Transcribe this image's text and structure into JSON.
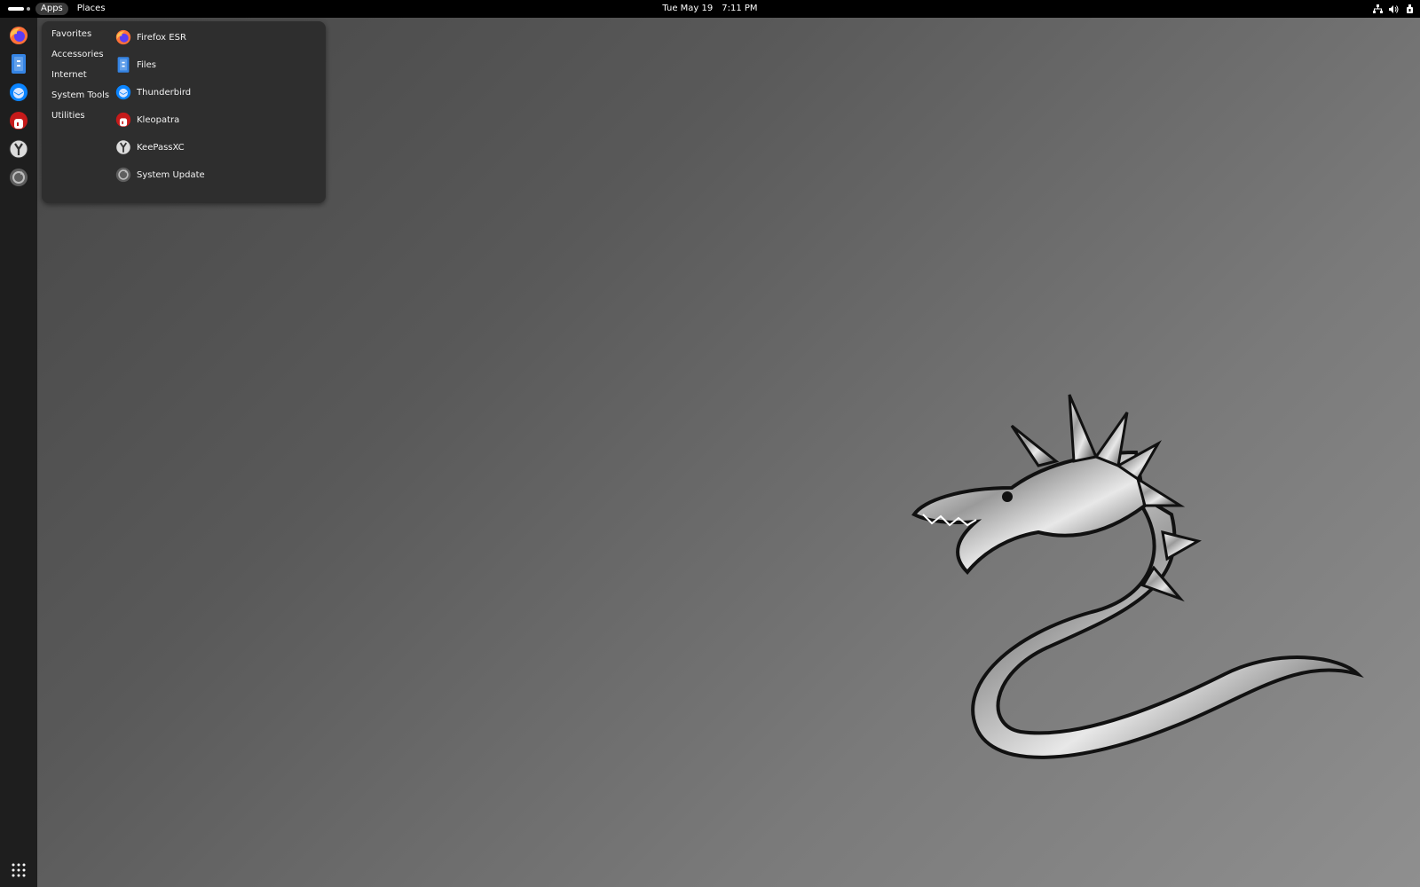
{
  "topbar": {
    "activities_icon": "activities-pill-icon",
    "menus": [
      {
        "label": "Apps",
        "active": true
      },
      {
        "label": "Places",
        "active": false
      }
    ],
    "clock": {
      "date": "Tue May 19",
      "time": "7:11 PM"
    },
    "tray_icons": [
      "network-icon",
      "volume-icon",
      "power-icon"
    ]
  },
  "dock": {
    "items": [
      {
        "name": "Firefox ESR",
        "icon": "firefox-icon"
      },
      {
        "name": "Files",
        "icon": "files-icon"
      },
      {
        "name": "Thunderbird",
        "icon": "thunderbird-icon"
      },
      {
        "name": "Kleopatra",
        "icon": "kleopatra-icon"
      },
      {
        "name": "KeePassXC",
        "icon": "keepassxc-icon"
      },
      {
        "name": "System Update",
        "icon": "system-update-icon"
      }
    ],
    "show_apps_icon": "app-grid-icon"
  },
  "apps_menu": {
    "categories": [
      "Favorites",
      "Accessories",
      "Internet",
      "System Tools",
      "Utilities"
    ],
    "apps": [
      {
        "label": "Firefox ESR",
        "icon": "firefox-icon"
      },
      {
        "label": "Files",
        "icon": "files-icon"
      },
      {
        "label": "Thunderbird",
        "icon": "thunderbird-icon"
      },
      {
        "label": "Kleopatra",
        "icon": "kleopatra-icon"
      },
      {
        "label": "KeePassXC",
        "icon": "keepassxc-icon"
      },
      {
        "label": "System Update",
        "icon": "system-update-icon"
      }
    ]
  },
  "colors": {
    "topbar_bg": "#000000",
    "dock_bg": "#1e1e1e",
    "menu_bg": "#2e2e2e",
    "firefox_orange": "#ff7139",
    "files_blue": "#3584e4",
    "thunderbird_blue": "#0a84ff",
    "kleopatra_red": "#c61a1a"
  },
  "wallpaper": {
    "subject": "silver-dragon"
  }
}
